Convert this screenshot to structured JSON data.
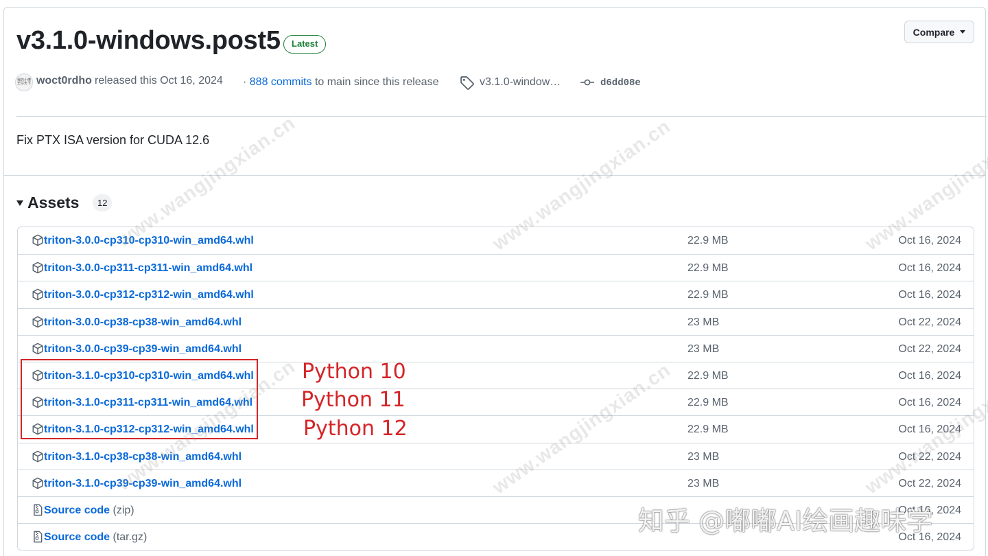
{
  "release": {
    "title": "v3.1.0-windows.post5",
    "latest_badge": "Latest",
    "compare_label": "Compare",
    "avatar_text": "我的小懂王仔天下",
    "author": "woct0rdho",
    "released_text": "released this Oct 16, 2024",
    "commits_prefix": "·",
    "commits_link": "888 commits",
    "commits_suffix": "to main since this release",
    "tag": "v3.1.0-window…",
    "sha": "d6dd08e",
    "body": "Fix PTX ISA version for CUDA 12.6"
  },
  "assets": {
    "heading": "Assets",
    "count": "12",
    "items": [
      {
        "name": "triton-3.0.0-cp310-cp310-win_amd64.whl",
        "size": "22.9 MB",
        "date": "Oct 16, 2024",
        "icon": "package-icon"
      },
      {
        "name": "triton-3.0.0-cp311-cp311-win_amd64.whl",
        "size": "22.9 MB",
        "date": "Oct 16, 2024",
        "icon": "package-icon"
      },
      {
        "name": "triton-3.0.0-cp312-cp312-win_amd64.whl",
        "size": "22.9 MB",
        "date": "Oct 16, 2024",
        "icon": "package-icon"
      },
      {
        "name": "triton-3.0.0-cp38-cp38-win_amd64.whl",
        "size": "23 MB",
        "date": "Oct 22, 2024",
        "icon": "package-icon"
      },
      {
        "name": "triton-3.0.0-cp39-cp39-win_amd64.whl",
        "size": "23 MB",
        "date": "Oct 22, 2024",
        "icon": "package-icon"
      },
      {
        "name": "triton-3.1.0-cp310-cp310-win_amd64.whl",
        "size": "22.9 MB",
        "date": "Oct 16, 2024",
        "icon": "package-icon"
      },
      {
        "name": "triton-3.1.0-cp311-cp311-win_amd64.whl",
        "size": "22.9 MB",
        "date": "Oct 16, 2024",
        "icon": "package-icon"
      },
      {
        "name": "triton-3.1.0-cp312-cp312-win_amd64.whl",
        "size": "22.9 MB",
        "date": "Oct 16, 2024",
        "icon": "package-icon"
      },
      {
        "name": "triton-3.1.0-cp38-cp38-win_amd64.whl",
        "size": "23 MB",
        "date": "Oct 22, 2024",
        "icon": "package-icon"
      },
      {
        "name": "triton-3.1.0-cp39-cp39-win_amd64.whl",
        "size": "23 MB",
        "date": "Oct 22, 2024",
        "icon": "package-icon"
      },
      {
        "name": "Source code",
        "suffix": "(zip)",
        "size": "",
        "date": "Oct 16, 2024",
        "icon": "file-zip-icon"
      },
      {
        "name": "Source code",
        "suffix": "(tar.gz)",
        "size": "",
        "date": "Oct 16, 2024",
        "icon": "file-zip-icon"
      }
    ]
  },
  "annotations": {
    "python10": "Python 10",
    "python11": "Python 11",
    "python12": "Python 12"
  },
  "watermark": {
    "text": "www.wangjingxian.cn",
    "zhihu": "知乎 @嘟嘟AI绘画趣味学"
  },
  "colors": {
    "link": "#0969da",
    "muted": "#59636e",
    "border": "#d0d7de",
    "latest_green": "#1a7f37",
    "annotation_red": "#d42528"
  }
}
